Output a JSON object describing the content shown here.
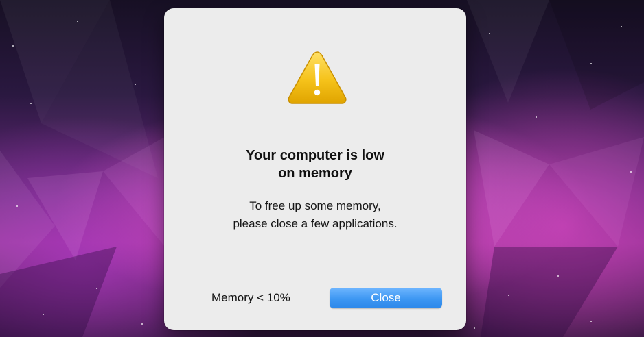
{
  "dialog": {
    "title_line1": "Your computer is low",
    "title_line2": "on memory",
    "message_line1": "To free up some memory,",
    "message_line2": "please close a few applications.",
    "memory_status": "Memory < 10%",
    "close_label": "Close",
    "icon": "warning-triangle-icon"
  },
  "colors": {
    "dialog_background": "#ececec",
    "button_blue": "#3d97f2",
    "warning_yellow": "#f5c21a",
    "desktop_purple": "#8a2f8e"
  }
}
